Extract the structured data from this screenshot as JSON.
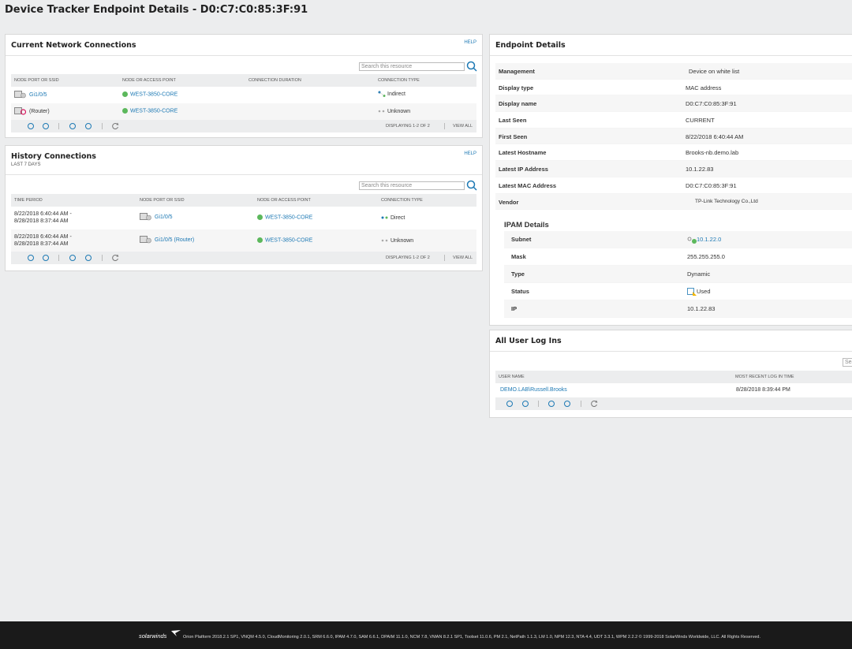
{
  "page": {
    "title": "Device Tracker Endpoint Details - D0:C7:C0:85:3F:91"
  },
  "current_connections": {
    "title": "Current Network Connections",
    "help": "HELP",
    "search_placeholder": "Search this resource",
    "columns": [
      "NODE PORT OR SSID",
      "NODE OR ACCESS POINT",
      "CONNECTION DURATION",
      "CONNECTION TYPE"
    ],
    "rows": [
      {
        "port": "Gi1/0/5",
        "node": "WEST-3850-CORE",
        "duration": "",
        "type": "Indirect"
      },
      {
        "port": "(Router)",
        "node": "WEST-3850-CORE",
        "duration": "",
        "type": "Unknown"
      }
    ],
    "pager": {
      "displaying": "DISPLAYING 1-2 OF 2",
      "view_all": "VIEW ALL"
    }
  },
  "history_connections": {
    "title": "History Connections",
    "subtitle": "LAST 7 DAYS",
    "help": "HELP",
    "search_placeholder": "Search this resource",
    "columns": [
      "TIME PERIOD",
      "NODE PORT OR SSID",
      "NODE OR ACCESS POINT",
      "CONNECTION TYPE"
    ],
    "rows": [
      {
        "time1": "8/22/2018 6:40:44 AM -",
        "time2": "8/28/2018 8:37:44 AM",
        "port": "Gi1/0/5",
        "node": "WEST-3850-CORE",
        "type": "Direct"
      },
      {
        "time1": "8/22/2018 6:40:44 AM -",
        "time2": "8/28/2018 8:37:44 AM",
        "port": "Gi1/0/5 (Router)",
        "node": "WEST-3850-CORE",
        "type": "Unknown"
      }
    ],
    "pager": {
      "displaying": "DISPLAYING 1-2 OF 2",
      "view_all": "VIEW ALL"
    }
  },
  "endpoint_details": {
    "title": "Endpoint Details",
    "rows": [
      {
        "key": "Management",
        "value": "Device on white list",
        "link": true
      },
      {
        "key": "Display type",
        "value": "MAC address",
        "link": false
      },
      {
        "key": "Display name",
        "value": "D0:C7:C0:85:3F:91",
        "link": false
      },
      {
        "key": "Last Seen",
        "value": "CURRENT",
        "link": false
      },
      {
        "key": "First Seen",
        "value": "8/22/2018 6:40:44 AM",
        "link": false
      },
      {
        "key": "Latest Hostname",
        "value": "Brooks-nb.demo.lab",
        "link": true
      },
      {
        "key": "Latest IP Address",
        "value": "10.1.22.83",
        "link": true
      },
      {
        "key": "Latest MAC Address",
        "value": "D0:C7:C0:85:3F:91",
        "link": true
      },
      {
        "key": "Vendor",
        "value": "TP-Link Technology Co.,Ltd",
        "link": false
      }
    ],
    "ipam": {
      "title": "IPAM Details",
      "rows": [
        {
          "key": "Subnet",
          "value": "10.1.22.0",
          "link": true
        },
        {
          "key": "Mask",
          "value": "255.255.255.0",
          "link": false
        },
        {
          "key": "Type",
          "value": "Dynamic",
          "link": false
        },
        {
          "key": "Status",
          "value": "Used",
          "link": false
        },
        {
          "key": "IP",
          "value": "10.1.22.83",
          "link": true
        }
      ]
    }
  },
  "user_logins": {
    "title": "All User Log Ins",
    "search_placeholder": "Sea",
    "columns": [
      "USER NAME",
      "MOST RECENT LOG IN TIME"
    ],
    "rows": [
      {
        "user": "DEMO.LAB\\Russell.Brooks",
        "time": "8/28/2018 8:39:44 PM"
      }
    ]
  },
  "footer": {
    "logo": "solarwinds",
    "text": "Orion Platform 2018.2.1 SP1, VNQM 4.5.0, CloudMonitoring 2.0.1, SRM 6.6.0, IPAM 4.7.0, SAM 6.6.1, DPAIM 11.1.0, NCM 7.8, VMAN 8.2.1 SP1, Toolset 11.0.6, PM 2.1, NetPath 1.1.3, LM 1.0, NPM 12.3, NTA 4.4, UDT 3.3.1, WPM 2.2.2 © 1999-2018 SolarWinds Worldwide, LLC. All Rights Reserved."
  },
  "colors": {
    "link": "#1d79b4",
    "status_up": "#5cb85c",
    "background": "#ecedee",
    "footer": "#1a1a1a"
  }
}
